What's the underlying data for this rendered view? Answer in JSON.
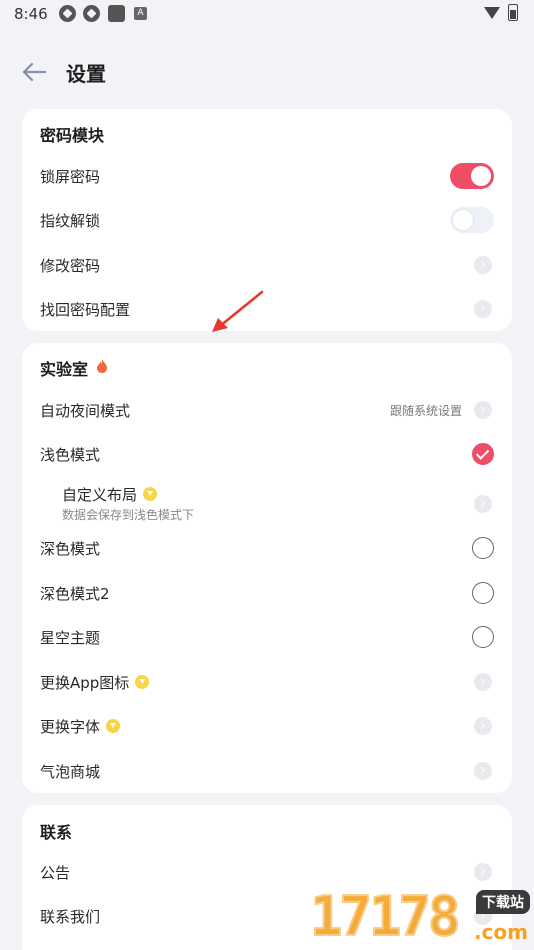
{
  "status_bar": {
    "time": "8:46",
    "a_icon": "A"
  },
  "header": {
    "title": "设置"
  },
  "password_section": {
    "title": "密码模块",
    "items": [
      {
        "label": "锁屏密码",
        "control": "toggle",
        "on": true
      },
      {
        "label": "指纹解锁",
        "control": "toggle",
        "on": false
      },
      {
        "label": "修改密码",
        "control": "chevron"
      },
      {
        "label": "找回密码配置",
        "control": "chevron"
      }
    ]
  },
  "lab_section": {
    "title": "实验室",
    "auto_night": {
      "label": "自动夜间模式",
      "value": "跟随系统设置"
    },
    "light_mode": {
      "label": "浅色模式",
      "checked": true
    },
    "custom_layout": {
      "label": "自定义布局",
      "desc": "数据会保存到浅色模式下"
    },
    "dark_mode": {
      "label": "深色模式",
      "checked": false
    },
    "dark_mode2": {
      "label": "深色模式2",
      "checked": false
    },
    "starry_theme": {
      "label": "星空主题",
      "checked": false
    },
    "change_app_icon": {
      "label": "更换App图标"
    },
    "change_font": {
      "label": "更换字体"
    },
    "bubble_store": {
      "label": "气泡商城"
    }
  },
  "contact_section": {
    "title": "联系",
    "items": [
      {
        "label": "公告"
      },
      {
        "label": "联系我们"
      }
    ]
  },
  "watermark": {
    "digits": "17178",
    "tag": "下载站",
    "domain": ".com"
  },
  "colors": {
    "accent": "#ee4d66",
    "background": "#f2f3f7",
    "vip": "#f7d547",
    "fire": "#f06a3c"
  }
}
